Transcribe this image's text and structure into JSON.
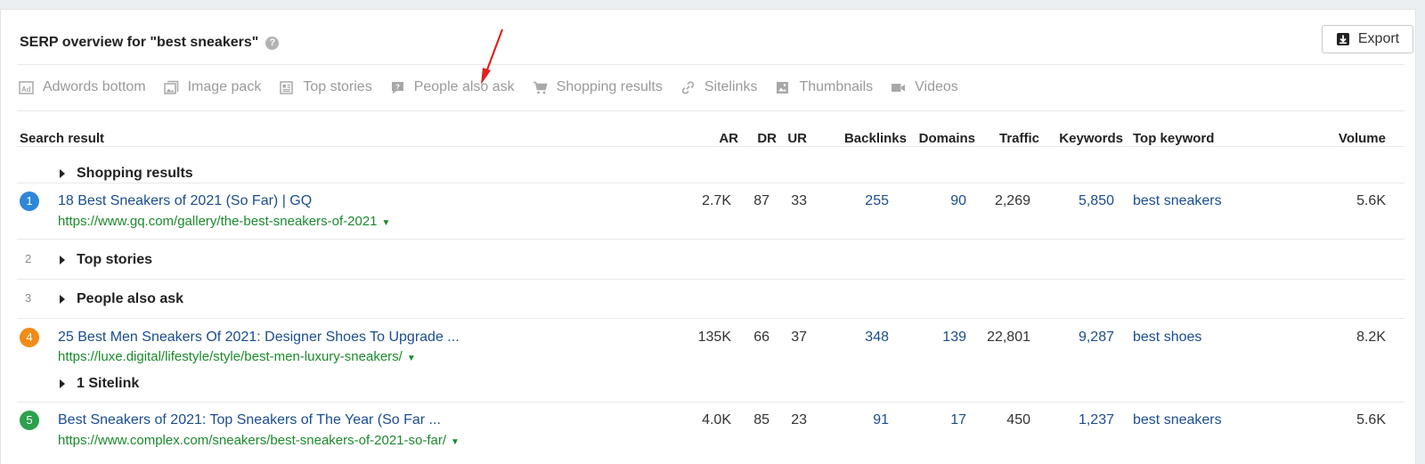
{
  "title": "SERP overview for \"best sneakers\"",
  "help_glyph": "?",
  "export_label": "Export",
  "features": [
    {
      "label": "Adwords bottom",
      "icon": "ad-icon"
    },
    {
      "label": "Image pack",
      "icon": "image-pack-icon"
    },
    {
      "label": "Top stories",
      "icon": "newspaper-icon"
    },
    {
      "label": "People also ask",
      "icon": "question-bubble-icon"
    },
    {
      "label": "Shopping results",
      "icon": "cart-icon"
    },
    {
      "label": "Sitelinks",
      "icon": "link-icon"
    },
    {
      "label": "Thumbnails",
      "icon": "thumbnail-icon"
    },
    {
      "label": "Videos",
      "icon": "video-camera-icon"
    }
  ],
  "columns": {
    "search_result": "Search result",
    "ar": "AR",
    "dr": "DR",
    "ur": "UR",
    "backlinks": "Backlinks",
    "domains": "Domains",
    "traffic": "Traffic",
    "keywords": "Keywords",
    "top_keyword": "Top keyword",
    "volume": "Volume"
  },
  "rows": {
    "shopping": {
      "label": "Shopping results"
    },
    "r1": {
      "num": "1",
      "color": "#2f86d8",
      "title": "18 Best Sneakers of 2021 (So Far) | GQ",
      "url": "https://www.gq.com/gallery/the-best-sneakers-of-2021",
      "ar": "2.7K",
      "dr": "87",
      "ur": "33",
      "backlinks": "255",
      "domains": "90",
      "traffic": "2,269",
      "keywords": "5,850",
      "top_keyword": "best sneakers",
      "volume": "5.6K"
    },
    "r2": {
      "num": "2",
      "label": "Top stories"
    },
    "r3": {
      "num": "3",
      "label": "People also ask"
    },
    "r4": {
      "num": "4",
      "color": "#f08c17",
      "title": "25 Best Men Sneakers Of 2021: Designer Shoes To Upgrade ...",
      "url": "https://luxe.digital/lifestyle/style/best-men-luxury-sneakers/",
      "ar": "135K",
      "dr": "66",
      "ur": "37",
      "backlinks": "348",
      "domains": "139",
      "traffic": "22,801",
      "keywords": "9,287",
      "top_keyword": "best shoes",
      "volume": "8.2K",
      "sitelink": "1 Sitelink"
    },
    "r5": {
      "num": "5",
      "color": "#2ba14b",
      "title": "Best Sneakers of 2021: Top Sneakers of The Year (So Far ...",
      "url": "https://www.complex.com/sneakers/best-sneakers-of-2021-so-far/",
      "ar": "4.0K",
      "dr": "85",
      "ur": "23",
      "backlinks": "91",
      "domains": "17",
      "traffic": "450",
      "keywords": "1,237",
      "top_keyword": "best sneakers",
      "volume": "5.6K"
    }
  },
  "caret_glyph": "▼",
  "colors": {
    "link": "#1a4d8f",
    "url": "#1b8a2c",
    "annotation_arrow": "#e02020"
  }
}
